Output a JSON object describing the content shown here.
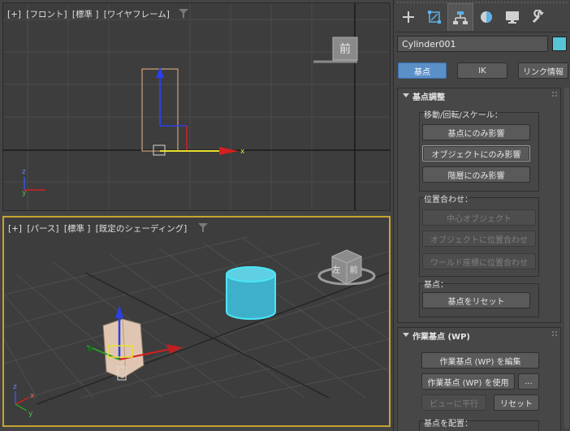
{
  "viewports": {
    "top": {
      "label_parts": [
        "[+]",
        "[フロント]",
        "[標準 ]",
        "[ワイヤフレーム]"
      ],
      "viewcube_label": "前"
    },
    "bottom": {
      "label_parts": [
        "[+]",
        "[パース]",
        "[標準 ]",
        "[既定のシェーディング]"
      ],
      "viewcube_label": "左 前"
    },
    "axis": {
      "x": "x",
      "y": "y",
      "z": "z"
    }
  },
  "panel": {
    "object_name": "Cylinder001",
    "object_color": "#58c5d6",
    "mode_buttons": {
      "pivot": "基点",
      "ik": "IK",
      "link_info": "リンク情報"
    },
    "pivot_adjust": {
      "title": "基点調整",
      "move_group_title": "移動/回転/スケール：",
      "affect_pivot_only": "基点にのみ影響",
      "affect_object_only": "オブジェクトにのみ影響",
      "affect_hierarchy_only": "階層にのみ影響",
      "align_group_title": "位置合わせ：",
      "center_to_object": "中心オブジェクト",
      "align_to_object": "オブジェクトに位置合わせ",
      "align_to_world": "ワールド座標に位置合わせ",
      "pivot_group_title": "基点：",
      "reset_pivot": "基点をリセット"
    },
    "working_pivot": {
      "title": "作業基点 (WP)",
      "edit_wp": "作業基点 (WP) を編集",
      "use_wp": "作業基点 (WP) を使用",
      "more": "...",
      "align_to_view": "ビューに平行",
      "reset": "リセット",
      "place_pivot_title": "基点を配置："
    }
  }
}
